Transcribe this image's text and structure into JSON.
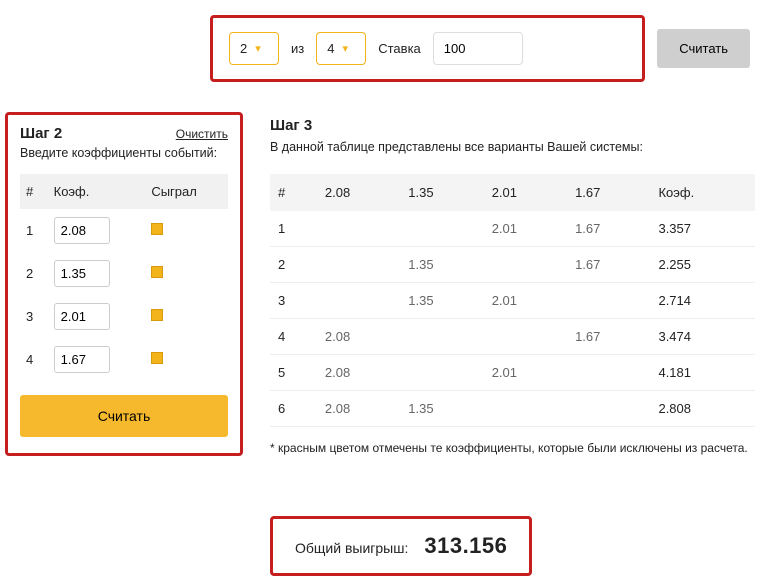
{
  "top": {
    "pick": "2",
    "of_label": "из",
    "total": "4",
    "bet_label": "Ставка",
    "bet_value": "100",
    "calc_label": "Считать"
  },
  "step2": {
    "title": "Шаг 2",
    "clear": "Очистить",
    "subtitle": "Введите коэффициенты событий:",
    "head_num": "#",
    "head_coef": "Коэф.",
    "head_played": "Сыграл",
    "rows": [
      {
        "n": "1",
        "coef": "2.08"
      },
      {
        "n": "2",
        "coef": "1.35"
      },
      {
        "n": "3",
        "coef": "2.01"
      },
      {
        "n": "4",
        "coef": "1.67"
      }
    ],
    "calc_label": "Считать"
  },
  "step3": {
    "title": "Шаг 3",
    "subtitle": "В данной таблице представлены все варианты Вашей системы:",
    "head_num": "#",
    "head_c1": "2.08",
    "head_c2": "1.35",
    "head_c3": "2.01",
    "head_c4": "1.67",
    "head_coef": "Коэф.",
    "rows": [
      {
        "n": "1",
        "c1": "",
        "c2": "",
        "c3": "2.01",
        "c4": "1.67",
        "coef": "3.357"
      },
      {
        "n": "2",
        "c1": "",
        "c2": "1.35",
        "c3": "",
        "c4": "1.67",
        "coef": "2.255"
      },
      {
        "n": "3",
        "c1": "",
        "c2": "1.35",
        "c3": "2.01",
        "c4": "",
        "coef": "2.714"
      },
      {
        "n": "4",
        "c1": "2.08",
        "c2": "",
        "c3": "",
        "c4": "1.67",
        "coef": "3.474"
      },
      {
        "n": "5",
        "c1": "2.08",
        "c2": "",
        "c3": "2.01",
        "c4": "",
        "coef": "4.181"
      },
      {
        "n": "6",
        "c1": "2.08",
        "c2": "1.35",
        "c3": "",
        "c4": "",
        "coef": "2.808"
      }
    ],
    "note": "* красным цветом отмечены те коэффициенты, которые были исключены из расчета."
  },
  "total": {
    "label": "Общий выигрыш:",
    "value": "313.156"
  }
}
